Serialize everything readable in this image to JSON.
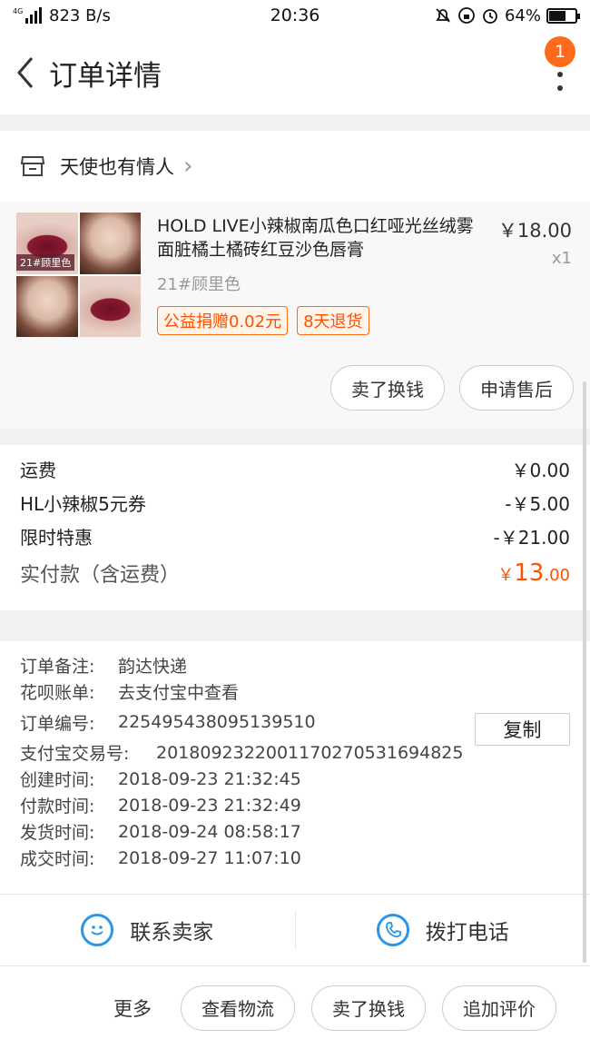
{
  "status_bar": {
    "network": "4G",
    "speed": "823 B/s",
    "time": "20:36",
    "battery": "64%",
    "battery_level": 0.64
  },
  "nav": {
    "title": "订单详情",
    "badge": "1"
  },
  "shop": {
    "name": "天使也有情人"
  },
  "item": {
    "thumb_tag": "21#顾里色",
    "title": "HOLD LIVE小辣椒南瓜色口红哑光丝绒雾面脏橘土橘砖红豆沙色唇膏",
    "price": "￥18.00",
    "quantity": "x1",
    "sku": "21#顾里色",
    "tags": [
      "公益捐赠0.02元",
      "8天退货"
    ],
    "buttons": [
      "卖了换钱",
      "申请售后"
    ]
  },
  "fees": {
    "rows": [
      {
        "label": "运费",
        "value": "￥0.00"
      },
      {
        "label": "HL小辣椒5元券",
        "value": "-￥5.00"
      },
      {
        "label": "限时特惠",
        "value": "-￥21.00"
      }
    ],
    "total_label": "实付款（含运费）",
    "total_currency": "￥",
    "total_int": "13",
    "total_dec": ".00"
  },
  "info": {
    "remark_label": "订单备注:",
    "remark_value": "韵达快递",
    "huabei_label": "花呗账单:",
    "huabei_value": "去支付宝中查看",
    "order_no_label": "订单编号:",
    "order_no_value": "225495438095139510",
    "copy_label": "复制",
    "alipay_label": "支付宝交易号:",
    "alipay_value": "2018092322001170270531694825",
    "created_label": "创建时间:",
    "created_value": "2018-09-23 21:32:45",
    "paid_label": "付款时间:",
    "paid_value": "2018-09-23 21:32:49",
    "shipped_label": "发货时间:",
    "shipped_value": "2018-09-24 08:58:17",
    "done_label": "成交时间:",
    "done_value": "2018-09-27 11:07:10"
  },
  "contact": {
    "seller_label": "联系卖家",
    "phone_label": "拨打电话"
  },
  "bottom_bar": {
    "more_label": "更多",
    "buttons": [
      "查看物流",
      "卖了换钱",
      "追加评价"
    ]
  },
  "colors": {
    "accent": "#ff5000",
    "badge": "#ff6a1a",
    "contact_icon": "#2a96e8"
  }
}
